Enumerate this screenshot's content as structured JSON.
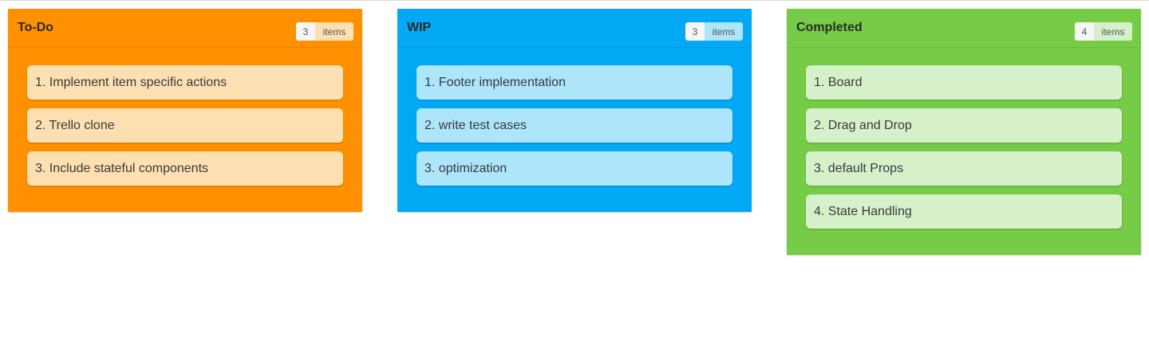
{
  "columns": [
    {
      "title": "To-Do",
      "count": "3",
      "count_label": "items",
      "color": "#ff9100",
      "cards": [
        "1. Implement item specific actions",
        "2. Trello clone",
        "3. Include stateful components"
      ]
    },
    {
      "title": "WIP",
      "count": "3",
      "count_label": "items",
      "color": "#03a9f4",
      "cards": [
        "1. Footer implementation",
        "2. write test cases",
        "3. optimization"
      ]
    },
    {
      "title": "Completed",
      "count": "4",
      "count_label": "items",
      "color": "#76cc46",
      "cards": [
        "1. Board",
        "2. Drag and Drop",
        "3. default Props",
        "4. State Handling"
      ]
    }
  ]
}
